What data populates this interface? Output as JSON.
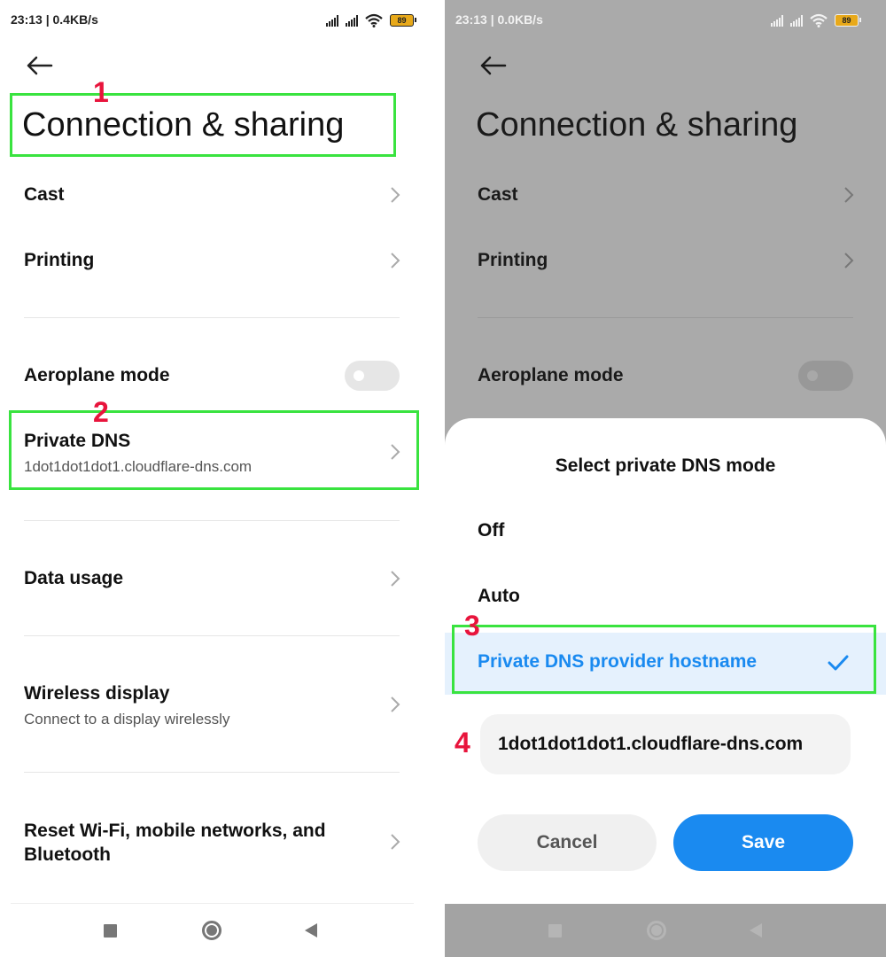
{
  "left": {
    "status": {
      "text": "23:13 | 0.4KB/s",
      "battery": "89"
    },
    "title": "Connection & sharing",
    "items": {
      "cast": "Cast",
      "printing": "Printing",
      "aeroplane": "Aeroplane mode",
      "private_dns": {
        "title": "Private DNS",
        "subtitle": "1dot1dot1dot1.cloudflare-dns.com"
      },
      "data_usage": "Data usage",
      "wireless_display": {
        "title": "Wireless display",
        "subtitle": "Connect to a display wirelessly"
      },
      "reset": {
        "line1": "Reset Wi-Fi, mobile networks, and",
        "line2": "Bluetooth"
      }
    },
    "toggles": {
      "aeroplane_on": false
    }
  },
  "right": {
    "status": {
      "text": "23:13 | 0.0KB/s",
      "battery": "89"
    },
    "title": "Connection & sharing",
    "items": {
      "cast": "Cast",
      "printing": "Printing",
      "aeroplane": "Aeroplane mode"
    },
    "dialog": {
      "title": "Select private DNS mode",
      "options": [
        "Off",
        "Auto",
        "Private DNS provider hostname"
      ],
      "selected_index": 2,
      "hostname_value": "1dot1dot1dot1.cloudflare-dns.com",
      "cancel_label": "Cancel",
      "save_label": "Save"
    }
  },
  "annotations": [
    "1",
    "2",
    "3",
    "4"
  ],
  "colors": {
    "accent": "#1a8af0",
    "highlight": "#39e33f",
    "marker": "#e8143c",
    "scrim": "#aaaaaa",
    "selected_bg": "#e5f1fd"
  },
  "icons": [
    "back-arrow-icon",
    "chevron-right-icon",
    "signal-icon",
    "wifi-icon",
    "battery-icon",
    "checkmark-icon",
    "nav-recents-icon",
    "nav-home-icon",
    "nav-back-icon"
  ]
}
